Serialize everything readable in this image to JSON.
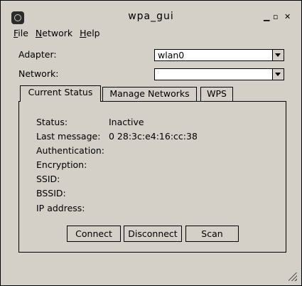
{
  "window": {
    "title": "wpa_gui",
    "minimize_glyph": "▁",
    "maximize_glyph": "▫",
    "close_glyph": "✕"
  },
  "menubar": {
    "items": [
      {
        "mnemonic": "F",
        "rest": "ile"
      },
      {
        "mnemonic": "N",
        "rest": "etwork"
      },
      {
        "mnemonic": "H",
        "rest": "elp"
      }
    ]
  },
  "form": {
    "adapter_label": "Adapter:",
    "adapter_value": "wlan0",
    "network_label": "Network:",
    "network_value": ""
  },
  "tabs": [
    {
      "label": "Current Status",
      "active": true
    },
    {
      "label": "Manage Networks",
      "active": false
    },
    {
      "label": "WPS",
      "active": false
    }
  ],
  "status": {
    "status_label": "Status:",
    "status_value": "Inactive",
    "last_message_label": "Last message:",
    "last_message_value": "0 28:3c:e4:16:cc:38",
    "authentication_label": "Authentication:",
    "encryption_label": "Encryption:",
    "ssid_label": "SSID:",
    "bssid_label": "BSSID:",
    "ip_address_label": "IP address:"
  },
  "buttons": {
    "connect": "Connect",
    "disconnect": "Disconnect",
    "scan": "Scan"
  },
  "icons": {
    "app_icon": "wpa-gui-icon",
    "resize_grip": "resize-grip-icon"
  }
}
